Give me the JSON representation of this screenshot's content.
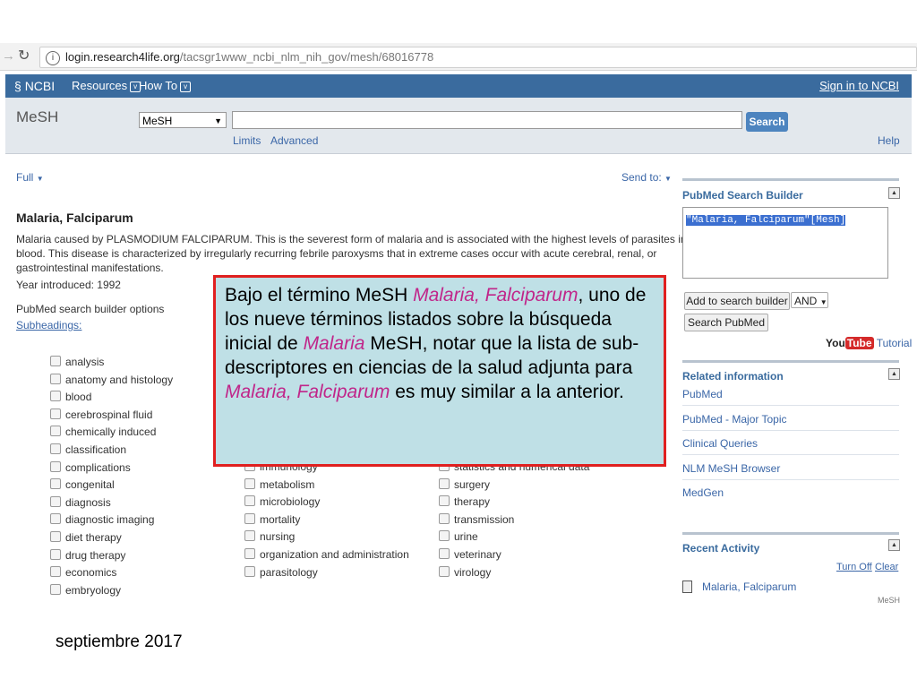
{
  "browser": {
    "url_host": "login.research4life.org",
    "url_path": "/tacsgr1www_ncbi_nlm_nih_gov/mesh/68016778"
  },
  "ncbi_header": {
    "logo": "NCBI",
    "resources": "Resources",
    "howto": "How To",
    "signin": "Sign in to NCBI"
  },
  "search": {
    "db_label": "MeSH",
    "db_selected": "MeSH",
    "query": "",
    "button": "Search",
    "limits": "Limits",
    "advanced": "Advanced",
    "help": "Help"
  },
  "record": {
    "format": "Full",
    "send_to": "Send to:",
    "title": "Malaria, Falciparum",
    "desc_line1": "Malaria caused by PLASMODIUM FALCIPARUM. This is the severest form of malaria and is associated with the highest levels of parasites in the",
    "desc_line2": "blood. This disease is characterized by irregularly recurring febrile paroxysms that in extreme cases occur with acute cerebral, renal, or",
    "desc_line3": "gastrointestinal manifestations.",
    "year": "Year introduced: 1992",
    "builder_options": "PubMed search builder options",
    "subheadings": "Subheadings:"
  },
  "subheadings_col1": [
    "analysis",
    "anatomy and histology",
    "blood",
    "cerebrospinal fluid",
    "chemically induced",
    "classification",
    "complications",
    "congenital",
    "diagnosis",
    "diagnostic imaging",
    "diet therapy",
    "drug therapy",
    "economics",
    "embryology"
  ],
  "subheadings_col2": [
    "immunology",
    "metabolism",
    "microbiology",
    "mortality",
    "nursing",
    "organization and administration",
    "parasitology"
  ],
  "subheadings_col3": [
    "statistics and numerical data",
    "surgery",
    "therapy",
    "transmission",
    "urine",
    "veterinary",
    "virology"
  ],
  "builder": {
    "title": "PubMed Search Builder",
    "query": "\"Malaria, Falciparum\"[Mesh]",
    "add_button": "Add to search builder",
    "operator": "AND",
    "search_button": "Search PubMed",
    "youtube_you": "You",
    "youtube_tube": "Tube",
    "tutorial": "Tutorial"
  },
  "related": {
    "title": "Related information",
    "items": [
      "PubMed",
      "PubMed - Major Topic",
      "Clinical Queries",
      "NLM MeSH Browser",
      "MedGen"
    ]
  },
  "recent": {
    "title": "Recent Activity",
    "turn_off": "Turn Off",
    "clear": "Clear",
    "item": "Malaria, Falciparum",
    "item_db": "MeSH"
  },
  "callout": {
    "t1": "Bajo el término MeSH ",
    "e1": "Malaria, Falciparum",
    "t2": ", uno de los nueve términos listados sobre la búsqueda inicial de ",
    "e2": "Malaria",
    "t3": " MeSH, notar que la lista de sub-descriptores en ciencias de la salud adjunta para ",
    "e3": "Malaria, Falciparum",
    "t4": " es muy similar a la anterior."
  },
  "footer": "septiembre 2017",
  "colors": {
    "ncbi_blue": "#3a6b9e",
    "link": "#3a66a7",
    "callout_bg": "#bfe0e6",
    "callout_border": "#e02020",
    "emphasis": "#c0268a"
  }
}
